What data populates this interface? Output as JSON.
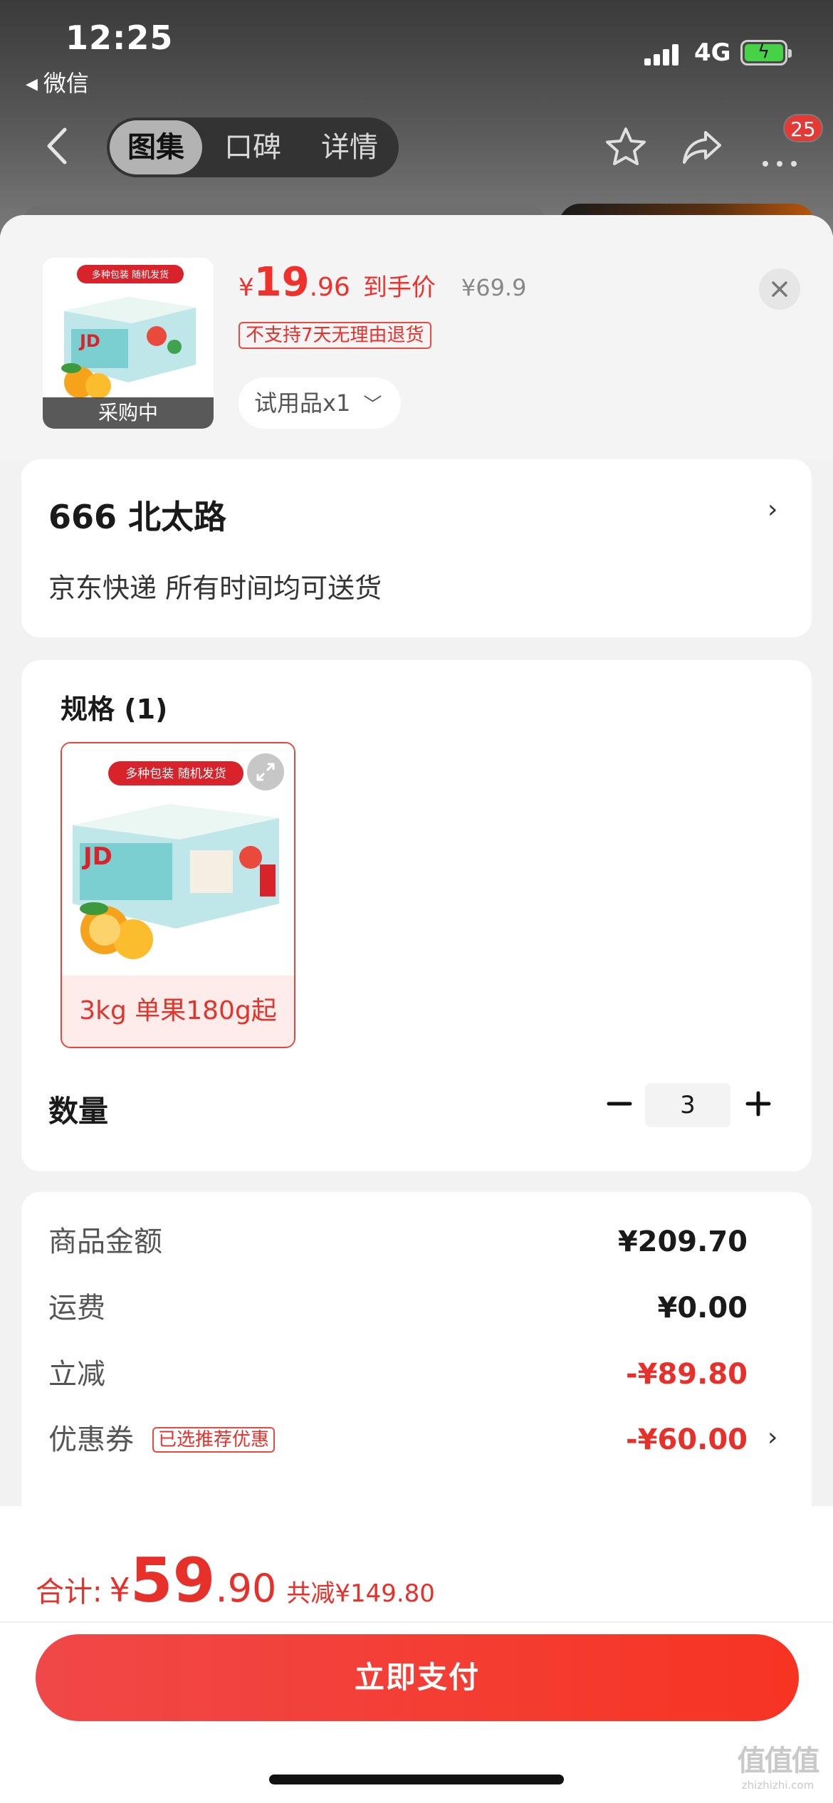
{
  "status_bar": {
    "time": "12:25",
    "back_app": "微信",
    "network": "4G"
  },
  "nav": {
    "tabs": [
      {
        "label": "图集",
        "active": true
      },
      {
        "label": "口碑",
        "active": false
      },
      {
        "label": "详情",
        "active": false
      }
    ],
    "badge_count": "25",
    "icons": [
      "back-arrow-icon",
      "star-icon",
      "share-icon",
      "more-icon"
    ]
  },
  "product": {
    "thumb_status": "采购中",
    "box_banner": "多种包装 随机发货",
    "price_symbol": "¥",
    "price_int": "19",
    "price_dec": ".96",
    "price_tag": "到手价",
    "original_price": "¥69.9",
    "return_notice": "不支持7天无理由退货",
    "variant": "试用品x1"
  },
  "address": {
    "title": "666  北太路",
    "delivery": "京东快递 所有时间均可送货"
  },
  "spec": {
    "title": "规格 (1)",
    "items": [
      {
        "label": "3kg 单果180g起",
        "banner": "多种包装 随机发货",
        "selected": true
      }
    ]
  },
  "quantity": {
    "label": "数量",
    "value": "3"
  },
  "fees": [
    {
      "label": "商品金额",
      "value": "¥209.70",
      "red": false
    },
    {
      "label": "运费",
      "value": "¥0.00",
      "red": false
    },
    {
      "label": "立减",
      "value": "-¥89.80",
      "red": true
    },
    {
      "label": "优惠券",
      "value": "-¥60.00",
      "red": true,
      "tag": "已选推荐优惠"
    }
  ],
  "footer": {
    "total_label": "合计:",
    "total_symbol": "¥",
    "total_int": "59",
    "total_dec": ".90",
    "saved": "共减¥149.80",
    "pay_button": "立即支付"
  },
  "watermark": {
    "glyphs": "值值值",
    "domain": "zhizhizhi.com"
  },
  "colors": {
    "accent_red": "#f0302a",
    "light_red_bg": "#fdecea",
    "sheet_bg": "#f2f2f2"
  }
}
